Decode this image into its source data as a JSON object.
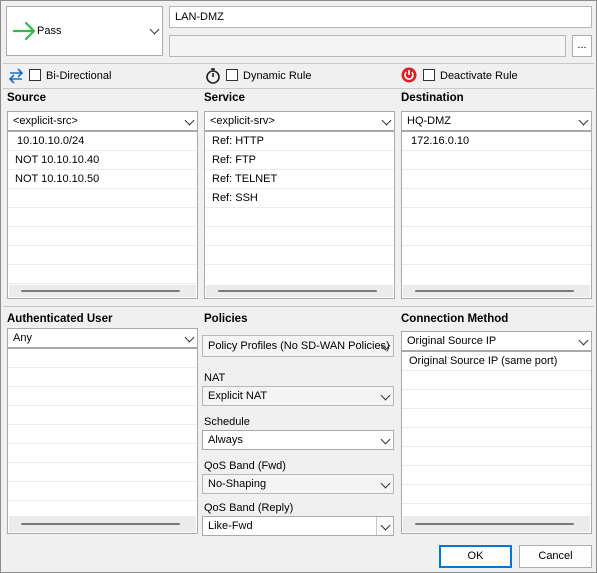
{
  "action": {
    "label": "Pass"
  },
  "rule_name": {
    "value": "LAN-DMZ"
  },
  "comment_field": {
    "value": ""
  },
  "browse_button": {
    "label": "..."
  },
  "options": {
    "bidirectional": "Bi-Directional",
    "dynamic_rule": "Dynamic Rule",
    "deactivate_rule": "Deactivate Rule"
  },
  "source": {
    "header": "Source",
    "selected": "<explicit-src>",
    "items": [
      "10.10.10.0/24",
      "NOT 10.10.10.40",
      "NOT 10.10.10.50"
    ]
  },
  "service": {
    "header": "Service",
    "selected": "<explicit-srv>",
    "items": [
      "Ref: HTTP",
      "Ref: FTP",
      "Ref: TELNET",
      "Ref: SSH"
    ]
  },
  "destination": {
    "header": "Destination",
    "selected": "HQ-DMZ",
    "items": [
      "172.16.0.10"
    ]
  },
  "auth_user": {
    "header": "Authenticated User",
    "selected": "Any"
  },
  "policies": {
    "header": "Policies",
    "policy_profile": "Policy Profiles (No SD-WAN Policies)",
    "nat_label": "NAT",
    "nat_value": "Explicit NAT",
    "schedule_label": "Schedule",
    "schedule_value": "Always",
    "qos_fwd_label": "QoS Band (Fwd)",
    "qos_fwd_value": "No-Shaping",
    "qos_reply_label": "QoS Band (Reply)",
    "qos_reply_value": "Like-Fwd"
  },
  "connection": {
    "header": "Connection Method",
    "selected": "Original Source IP",
    "items": [
      "Original Source IP (same port)"
    ]
  },
  "buttons": {
    "ok": "OK",
    "cancel": "Cancel"
  },
  "colors": {
    "pass_arrow": "#35b84a",
    "deactivate": "#e02020",
    "bidirectional": "#1a6fc4",
    "default_button": "#0078d7"
  }
}
